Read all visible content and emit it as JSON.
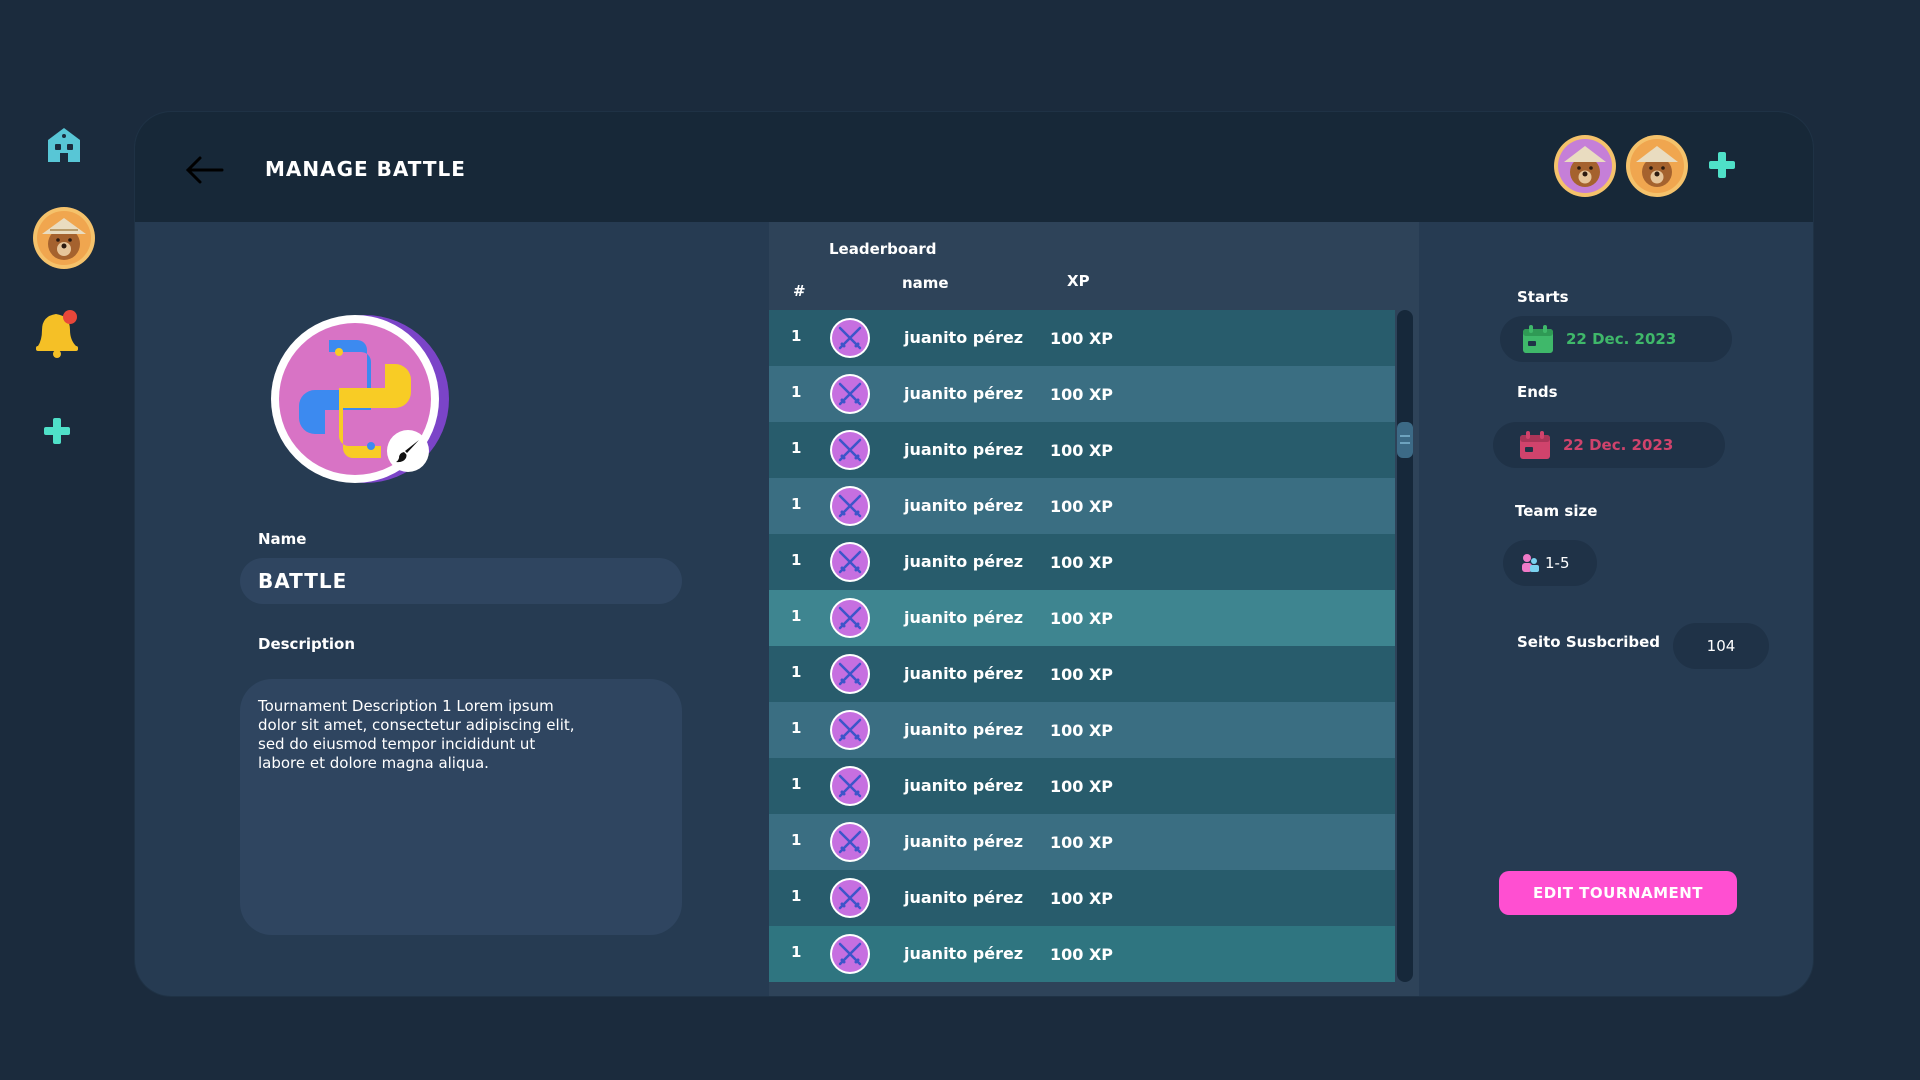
{
  "header": {
    "title": "MANAGE BATTLE"
  },
  "form": {
    "name_label": "Name",
    "name_value": "BATTLE",
    "description_label": "Description",
    "description_value": "Tournament Description 1 Lorem ipsum dolor sit amet, consectetur adipiscing elit, sed do eiusmod tempor incididunt ut labore et dolore magna aliqua."
  },
  "leaderboard": {
    "title": "Leaderboard",
    "columns": {
      "rank": "#",
      "name": "name",
      "xp": "XP"
    },
    "rows": [
      {
        "rank": "1",
        "name": "juanito pérez",
        "xp": "100 XP"
      },
      {
        "rank": "1",
        "name": "juanito pérez",
        "xp": "100 XP"
      },
      {
        "rank": "1",
        "name": "juanito pérez",
        "xp": "100 XP"
      },
      {
        "rank": "1",
        "name": "juanito pérez",
        "xp": "100 XP"
      },
      {
        "rank": "1",
        "name": "juanito pérez",
        "xp": "100 XP"
      },
      {
        "rank": "1",
        "name": "juanito pérez",
        "xp": "100 XP"
      },
      {
        "rank": "1",
        "name": "juanito pérez",
        "xp": "100 XP"
      },
      {
        "rank": "1",
        "name": "juanito pérez",
        "xp": "100 XP"
      },
      {
        "rank": "1",
        "name": "juanito pérez",
        "xp": "100 XP"
      },
      {
        "rank": "1",
        "name": "juanito pérez",
        "xp": "100 XP"
      },
      {
        "rank": "1",
        "name": "juanito pérez",
        "xp": "100 XP"
      },
      {
        "rank": "1",
        "name": "juanito pérez",
        "xp": "100 XP"
      }
    ],
    "row_colors": [
      "#285c6c",
      "#3a6e82",
      "#285c6c",
      "#3a6e82",
      "#285c6c",
      "#3e8590",
      "#285c6c",
      "#3a6e82",
      "#285c6c",
      "#3a6e82",
      "#285c6c",
      "#2f7580"
    ]
  },
  "details": {
    "starts_label": "Starts",
    "starts_date": "22 Dec. 2023",
    "ends_label": "Ends",
    "ends_date": "22 Dec. 2023",
    "team_size_label": "Team size",
    "team_size_value": "1-5",
    "subscribed_label": "Seito Susbcribed",
    "subscribed_value": "104",
    "edit_button": "EDIT TOURNAMENT"
  },
  "colors": {
    "accent_teal": "#4fe0c8",
    "start_green": "#3fb86a",
    "end_pink": "#d0436c",
    "button_pink": "#ff4fd1"
  },
  "icons": [
    "home-icon",
    "user-avatar",
    "bell-icon",
    "plus-icon",
    "back-arrow-icon",
    "python-logo",
    "brush-icon",
    "swords-icon",
    "calendar-icon",
    "team-icon"
  ]
}
